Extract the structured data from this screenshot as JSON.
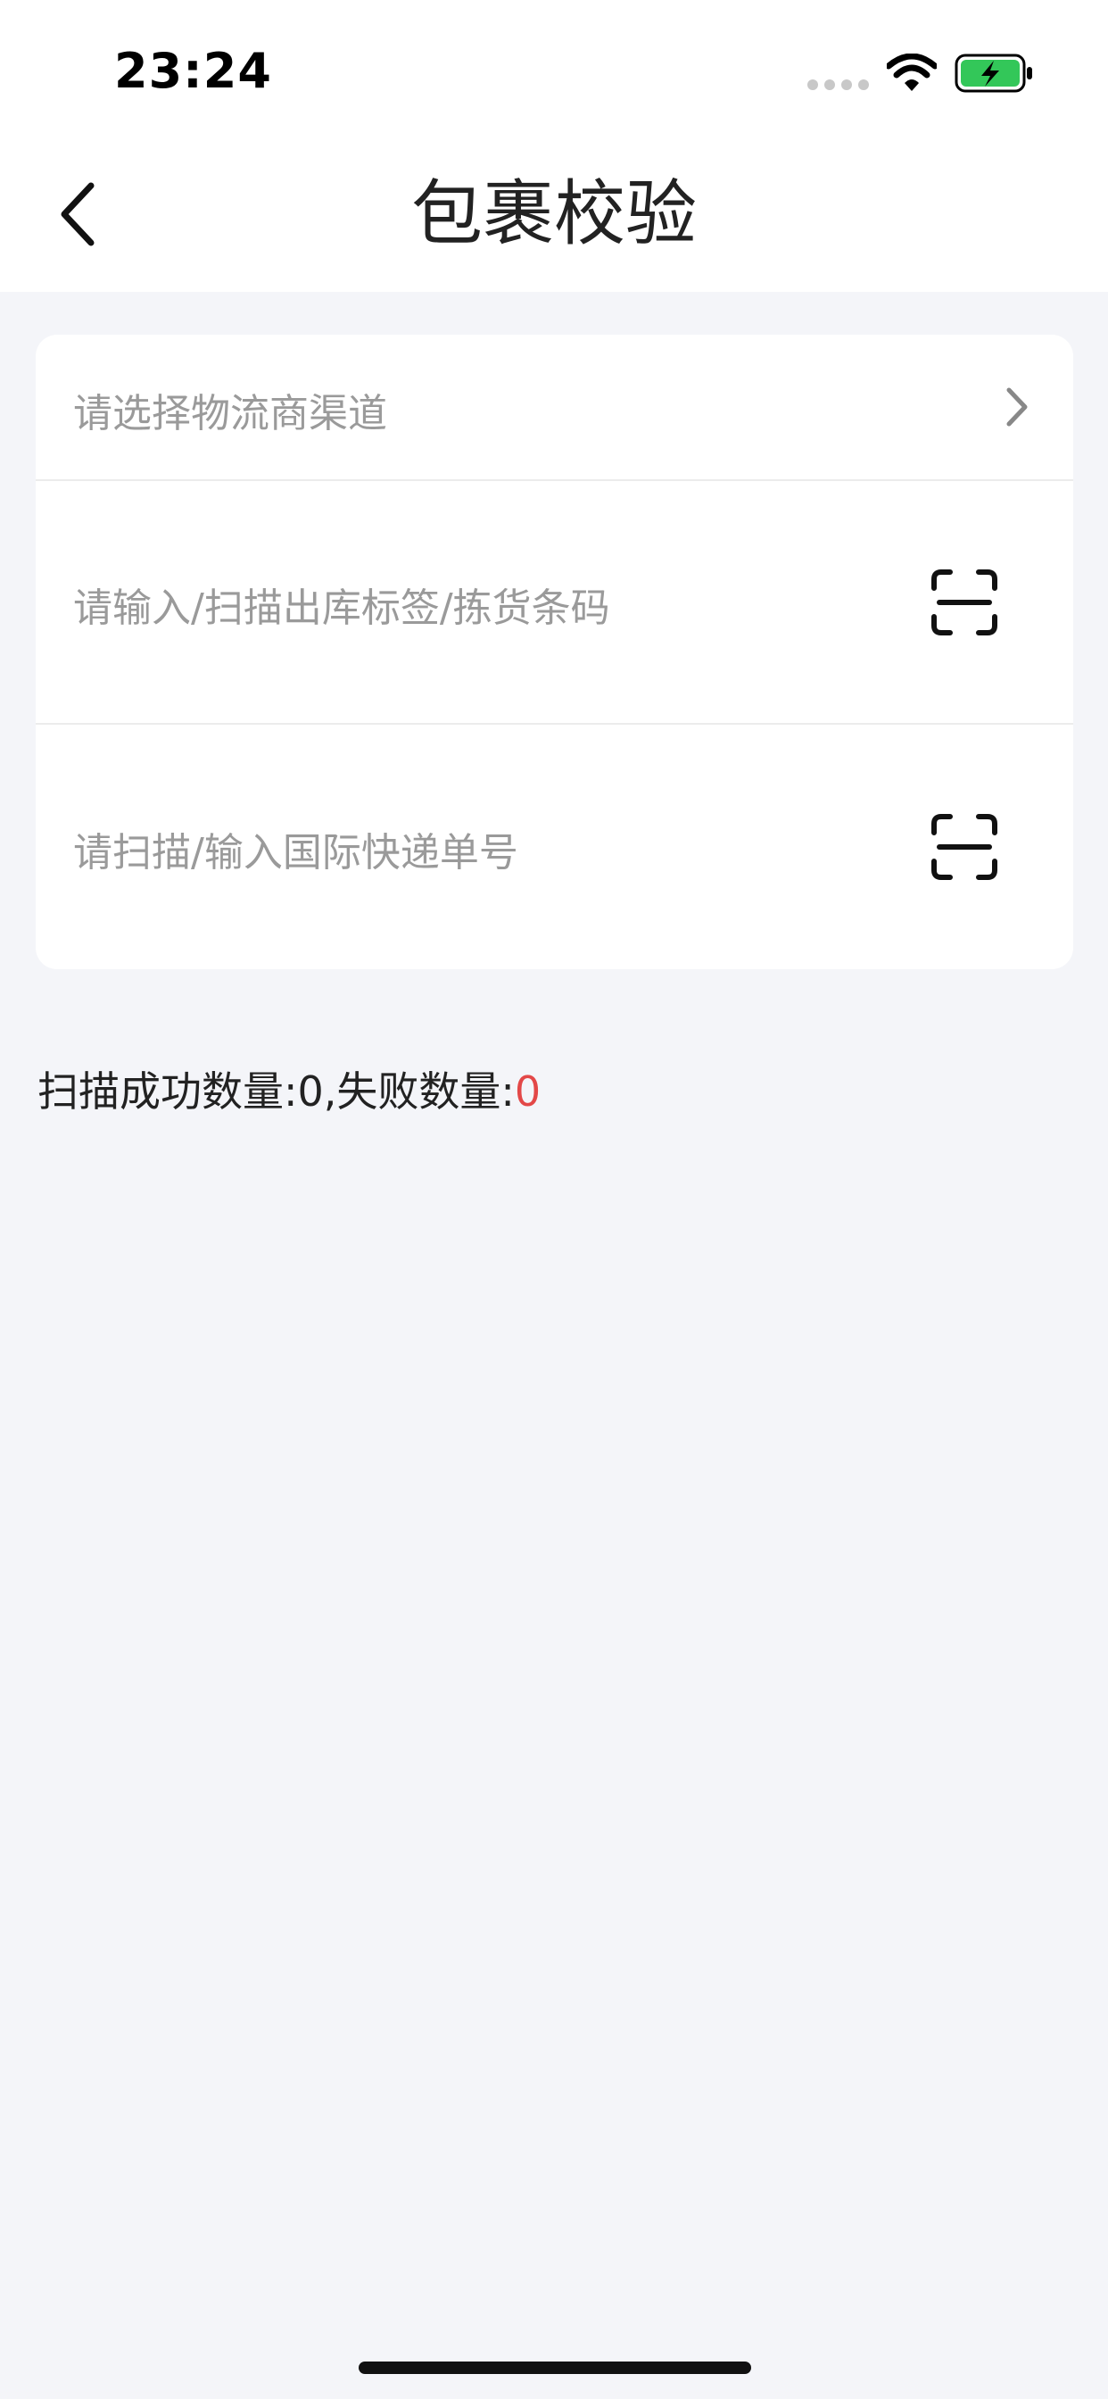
{
  "status_bar": {
    "time": "23:24"
  },
  "header": {
    "title": "包裹校验"
  },
  "form": {
    "channel_placeholder": "请选择物流商渠道",
    "label_input_placeholder": "请输入/扫描出库标签/拣货条码",
    "express_input_placeholder": "请扫描/输入国际快递单号"
  },
  "stats": {
    "success_label": "扫描成功数量:",
    "success_count": "0",
    "separator": ",",
    "fail_label": "失败数量:",
    "fail_count": "0"
  },
  "colors": {
    "fail_count": "#e34848",
    "battery_fill": "#33c759",
    "background": "#f4f5f9"
  }
}
